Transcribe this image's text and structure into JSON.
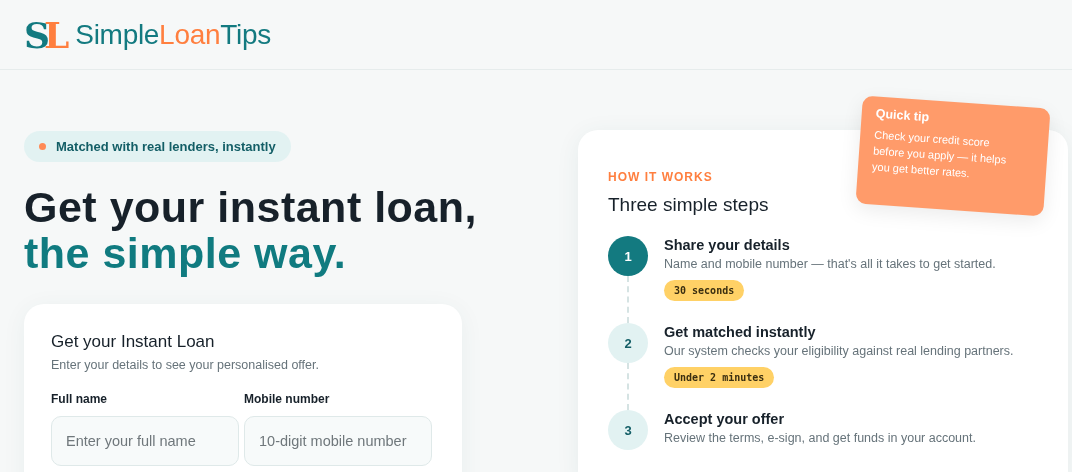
{
  "header": {
    "logo_mark": "SL",
    "brand": [
      {
        "text": "Simple",
        "accent": false
      },
      {
        "text": "Loan",
        "accent": true
      },
      {
        "text": "Tips",
        "accent": false
      }
    ]
  },
  "badge": "Matched with real lenders, instantly",
  "headline": {
    "line_1": "Get your instant loan,",
    "line_2": "the simple way."
  },
  "form": {
    "title": "Get your Instant Loan",
    "subtitle": "Enter your details to see your personalised offer.",
    "fields": [
      {
        "label": "Full name",
        "placeholder": "Enter your full name"
      },
      {
        "label": "Mobile number",
        "placeholder": "10-digit mobile number"
      }
    ]
  },
  "how_it_works": {
    "eyebrow": "HOW IT WORKS",
    "title": "Three simple steps",
    "steps": [
      {
        "number": "1",
        "active": true,
        "title": "Share your details",
        "text": "Name and mobile number — that's all it takes to get started.",
        "tag": "30 seconds"
      },
      {
        "number": "2",
        "active": false,
        "title": "Get matched instantly",
        "text": "Our system checks your eligibility against real lending partners.",
        "tag": "Under 2 minutes"
      },
      {
        "number": "3",
        "active": false,
        "title": "Accept your offer",
        "text": "Review the terms, e-sign, and get funds in your account."
      }
    ]
  },
  "quick_tip": {
    "title": "Quick tip",
    "text": "Check your credit score before you apply — it helps you get better rates."
  }
}
